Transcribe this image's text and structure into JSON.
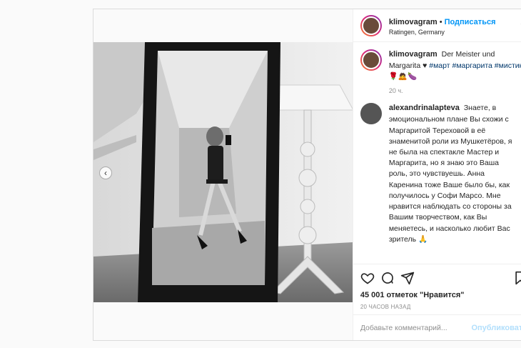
{
  "header": {
    "username": "klimovagram",
    "separator": "•",
    "follow_label": "Подписаться",
    "location": "Ratingen, Germany",
    "more_icon": "more-horizontal-icon"
  },
  "caption": {
    "username": "klimovagram",
    "text": "Der Meister und Margarita ♥",
    "hashtags": "#март #маргарита #мистика",
    "emojis": "🌹🙇🍆",
    "time": "20 ч."
  },
  "comment": {
    "username": "alexandrinalapteva",
    "text": "Знаете, в эмоциональном плане Вы схожи с Маргаритой Тереховой в её знаменитой роли из Мушкетёров, я не была на спектакле Мастер и Маргарита, но я знаю это Ваша роль, это чувствуешь. Анна Каренина тоже Ваше было бы, как получилось у Софи Марсо. Мне нравится наблюдать со стороны за Вашим творчеством, как Вы меняетесь, и насколько любит Вас зритель 🙏"
  },
  "actions": {
    "like_icon": "heart-icon",
    "comment_icon": "comment-icon",
    "share_icon": "share-icon",
    "save_icon": "bookmark-icon"
  },
  "likes": "45 001 отметок \"Нравится\"",
  "post_time": "20 ЧАСОВ НАЗАД",
  "add_comment": {
    "placeholder": "Добавьте комментарий...",
    "publish_label": "Опубликовать"
  },
  "colors": {
    "accent": "#0095f6",
    "publish_disabled": "#b2dffc",
    "hashtag": "#00376b",
    "secondary_text": "#8e8e8e"
  }
}
